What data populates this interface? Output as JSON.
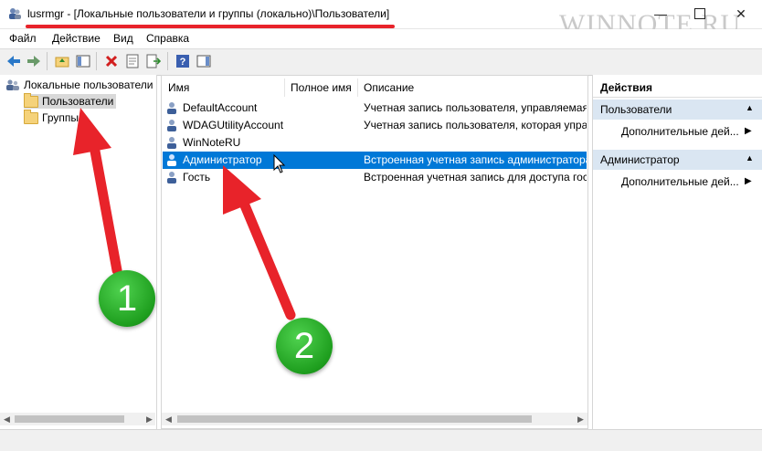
{
  "window": {
    "title": "lusrmgr - [Локальные пользователи и группы (локально)\\Пользователи]",
    "watermark": "WINNOTE.RU",
    "accent_color": "#e8232a"
  },
  "menu": [
    "Файл",
    "Действие",
    "Вид",
    "Справка"
  ],
  "tree": {
    "root": "Локальные пользователи",
    "items": [
      {
        "label": "Пользователи",
        "selected": true
      },
      {
        "label": "Группы",
        "selected": false
      }
    ]
  },
  "list": {
    "columns": [
      "Имя",
      "Полное имя",
      "Описание"
    ],
    "rows": [
      {
        "name": "DefaultAccount",
        "full_name": "",
        "description": "Учетная запись пользователя, управляемая с",
        "selected": false
      },
      {
        "name": "WDAGUtilityAccount",
        "full_name": "",
        "description": "Учетная запись пользователя, которая управ",
        "selected": false
      },
      {
        "name": "WinNoteRU",
        "full_name": "",
        "description": "",
        "selected": false
      },
      {
        "name": "Администратор",
        "full_name": "",
        "description": "Встроенная учетная запись администратора",
        "selected": true
      },
      {
        "name": "Гость",
        "full_name": "",
        "description": "Встроенная учетная запись для доступа гост",
        "selected": false
      }
    ],
    "selection_color": "#0078d7"
  },
  "actions": {
    "title": "Действия",
    "sections": [
      {
        "header": "Пользователи",
        "item": "Дополнительные дей..."
      },
      {
        "header": "Администратор",
        "item": "Дополнительные дей..."
      }
    ]
  },
  "annotations": {
    "badges": [
      "1",
      "2"
    ],
    "arrow_color": "#e8232a",
    "badge_color": "#1e9e1e"
  }
}
